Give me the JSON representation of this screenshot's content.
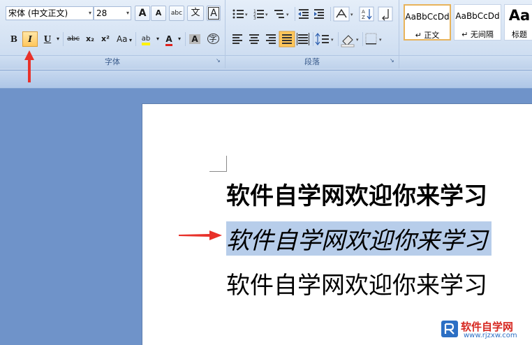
{
  "font_group": {
    "font_name": "宋体 (中文正文)",
    "font_size": "28",
    "label": "字体",
    "buttons": {
      "grow": "A",
      "shrink": "A",
      "clear": "abc",
      "phonetic": "文",
      "border": "A",
      "bold": "B",
      "italic": "I",
      "underline": "U",
      "strike": "abc",
      "subscript": "x₂",
      "superscript": "x²",
      "case": "Aa",
      "highlight": "ab",
      "font_color": "A",
      "shading": "A",
      "enclose": "字"
    }
  },
  "paragraph_group": {
    "label": "段落"
  },
  "styles_group": {
    "items": [
      {
        "sample": "AaBbCcDd",
        "name": "↵ 正文"
      },
      {
        "sample": "AaBbCcDd",
        "name": "↵ 无间隔"
      },
      {
        "sample": "Aa",
        "name": "标题"
      }
    ]
  },
  "document": {
    "lines": [
      "软件自学网欢迎你来学习",
      "软件自学网欢迎你来学习",
      "软件自学网欢迎你来学习"
    ]
  },
  "watermark": {
    "text": "软件自学网",
    "url": "www.rjzxw.com"
  },
  "colors": {
    "arrow": "#e8312a",
    "selection": "#b7cdea",
    "active_button": "#ffc75c"
  }
}
